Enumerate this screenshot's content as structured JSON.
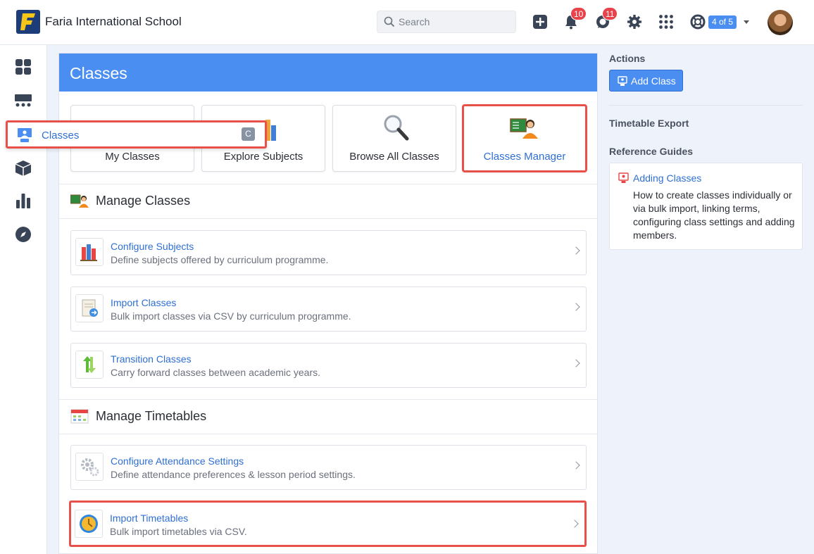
{
  "header": {
    "school_name": "Faria International School",
    "search_placeholder": "Search",
    "notifications_count": "10",
    "messages_count": "11",
    "pager": "4 of 5"
  },
  "sidebar": {
    "flyout": {
      "label": "Classes",
      "shortcut": "C"
    }
  },
  "main": {
    "title": "Classes",
    "tiles": [
      {
        "label": "My Classes"
      },
      {
        "label": "Explore Subjects"
      },
      {
        "label": "Browse All Classes"
      },
      {
        "label": "Classes Manager"
      }
    ],
    "manage_classes": {
      "title": "Manage Classes",
      "items": [
        {
          "title": "Configure Subjects",
          "desc": "Define subjects offered by curriculum programme."
        },
        {
          "title": "Import Classes",
          "desc": "Bulk import classes via CSV by curriculum programme."
        },
        {
          "title": "Transition Classes",
          "desc": "Carry forward classes between academic years."
        }
      ]
    },
    "manage_timetables": {
      "title": "Manage Timetables",
      "items": [
        {
          "title": "Configure Attendance Settings",
          "desc": "Define attendance preferences & lesson period settings."
        },
        {
          "title": "Import Timetables",
          "desc": "Bulk import timetables via CSV."
        }
      ]
    }
  },
  "right_panel": {
    "actions_heading": "Actions",
    "add_class_label": "Add Class",
    "timetable_export_heading": "Timetable Export",
    "reference_guides_heading": "Reference Guides",
    "guide": {
      "title": "Adding Classes",
      "desc": "How to create classes individually or via bulk import, linking terms, configuring class settings and adding members."
    }
  },
  "colors": {
    "accent": "#4a8ef2",
    "link": "#2f6fd3",
    "highlight": "#e8514a",
    "badge": "#e8424a"
  }
}
